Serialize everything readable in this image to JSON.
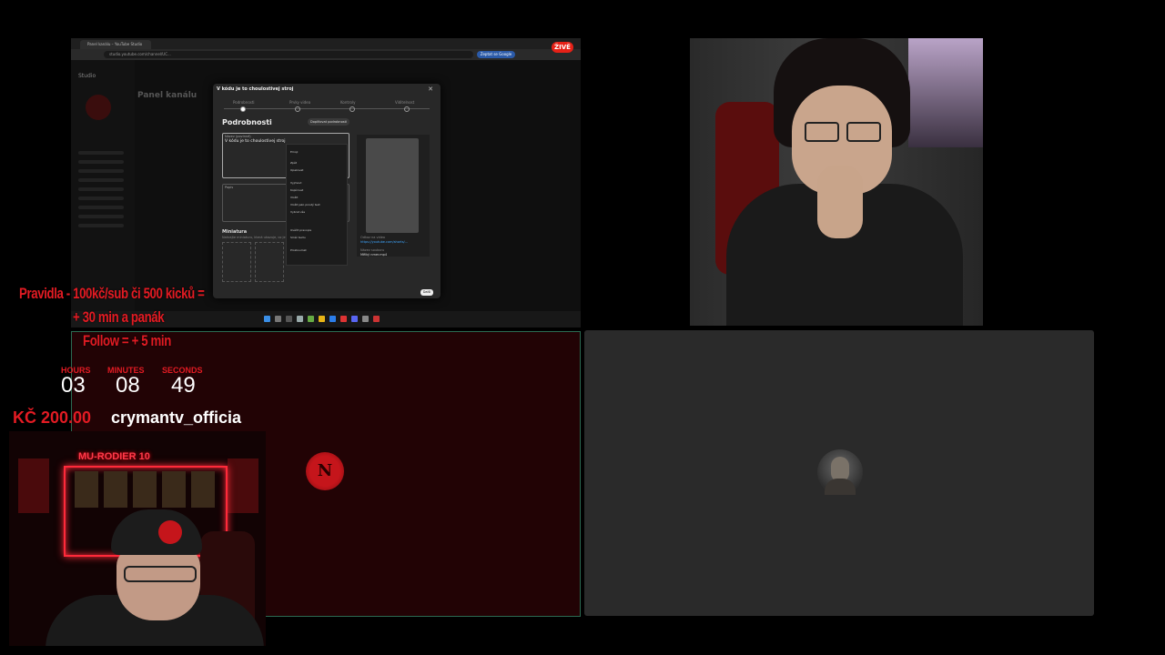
{
  "screen_share": {
    "browser_tab": "Panel kanálu – YouTube Studio",
    "url": "studio.youtube.com/channel/UC...",
    "google_button": "Zeptat se Google",
    "live_badge": "ŽIVĚ",
    "studio_logo": "Studio",
    "panel_title": "Panel kanálu",
    "dialog": {
      "title": "V kódu je to choulostivej stroj",
      "steps": [
        "Podrobnosti",
        "Prvky videa",
        "Kontroly",
        "Viditelnost"
      ],
      "details_heading": "Podrobnosti",
      "fill_button": "Doplňovat podrobnosti",
      "title_label": "Název (povinné)",
      "title_value": "V kódu je to choulostivej stroj",
      "description_label": "Popis",
      "thumbnail_heading": "Miniatura",
      "thumbnail_sub": "Nahrajte miniaturu, která ukazuje, co je ve videu.",
      "context_menu": [
        "Emoji",
        "Zpět",
        "Opakovat",
        "Vyjmout",
        "Kopírovat",
        "Vložit",
        "Vložit jako prostý text",
        "Vybrat vše",
        "Ověřit pravopis",
        "Směr textu",
        "Prozkoumat"
      ],
      "link_label": "Odkaz na video",
      "link_value": "https://youtube.com/shorts/...",
      "file_label": "Název souboru",
      "file_value": "Mělký nmer.mp4",
      "next_button": "Další"
    }
  },
  "overlay": {
    "rules_line1": "Pravidla - 100kč/sub či 500 kicků =",
    "rules_line2": "+ 30 min a panák",
    "follow_rule": "Follow = + 5 min",
    "timer": {
      "hours_label": "HOURS",
      "minutes_label": "MINUTES",
      "seconds_label": "SECONDS",
      "hours": "03",
      "minutes": "08",
      "seconds": "49"
    },
    "donation_amount": "KČ 200.00",
    "donor_name": "crymantv_officia",
    "neon_sign": "MU-RODIER 10"
  },
  "colors": {
    "accent_red": "#e21b23",
    "panel_red_bg": "#220305",
    "panel_gray_bg": "#2a2a2a",
    "panel_border": "#2c6b52"
  },
  "participants": [
    {
      "avatar": "red-n-logo-icon",
      "letter": "N"
    },
    {
      "avatar": "person-avatar-icon"
    }
  ]
}
